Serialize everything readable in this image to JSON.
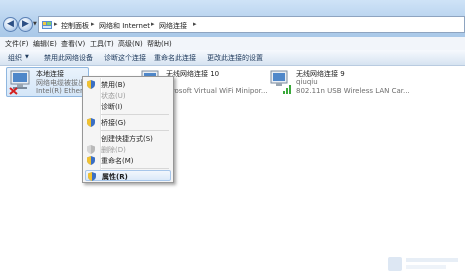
{
  "address": {
    "breadcrumbs": [
      "控制面板",
      "网络和 Internet",
      "网络连接"
    ]
  },
  "menubar": [
    "文件(F)",
    "编辑(E)",
    "查看(V)",
    "工具(T)",
    "高级(N)",
    "帮助(H)"
  ],
  "commandbar": {
    "organize": "组织",
    "items": [
      "禁用此网络设备",
      "诊断这个连接",
      "重命名此连接",
      "更改此连接的设置"
    ]
  },
  "connections": [
    {
      "name": "本地连接",
      "status": "网络电缆被拔出",
      "device": "Intel(R) Etherne"
    },
    {
      "name": "无线网络连接 10",
      "status": "",
      "device": "icrosoft Virtual WiFi Minipor..."
    },
    {
      "name": "无线网络连接 9",
      "status": "qiuqiu",
      "device": "802.11n USB Wireless LAN Car..."
    }
  ],
  "context_menu": [
    {
      "label": "禁用(B)",
      "shield": true,
      "disabled": false
    },
    {
      "label": "状态(U)",
      "shield": false,
      "disabled": true
    },
    {
      "label": "诊断(I)",
      "shield": false,
      "disabled": false
    },
    {
      "label": "桥接(G)",
      "shield": true,
      "disabled": false
    },
    {
      "label": "创建快捷方式(S)",
      "shield": false,
      "disabled": false
    },
    {
      "label": "删除(D)",
      "shield": true,
      "disabled": true
    },
    {
      "label": "重命名(M)",
      "shield": true,
      "disabled": false
    },
    {
      "label": "属性(R)",
      "shield": true,
      "disabled": false,
      "highlighted": true
    }
  ],
  "colors": {
    "window_frame": "#b7d2ee",
    "selection": "#d4e6f8",
    "highlight_border": "#a7c6ea",
    "shield_blue": "#3a6fc4",
    "shield_yellow": "#f2c230"
  }
}
